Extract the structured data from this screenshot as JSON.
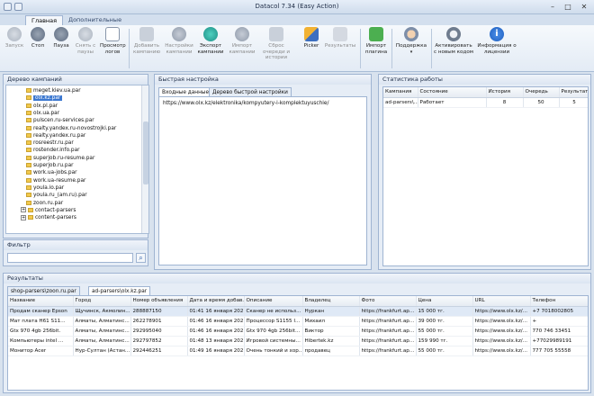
{
  "window": {
    "title": "Datacol 7.34 (Easy Action)"
  },
  "ribbon_tabs": [
    {
      "label": "Главная",
      "active": true
    },
    {
      "label": "Дополнительные",
      "active": false
    }
  ],
  "ribbon": {
    "start": "Запуск",
    "stop": "Стоп",
    "pause": "Пауза",
    "unpause": "Снять с паузы",
    "logs": "Просмотр логов",
    "add_campaign": "Добавить кампанию",
    "campaign_settings": "Настройки кампании",
    "export_campaigns": "Экспорт кампании",
    "import_campaigns": "Импорт кампании",
    "reset_queue": "Сброс очереди и истории",
    "picker": "Picker",
    "results": "Результаты",
    "import_plugin": "Импорт плагина",
    "support": "Поддержка",
    "activate_new_code": "Активировать с новым кодом",
    "license_info": "Информация о лицензии"
  },
  "campaign_tree": {
    "title": "Дерево кампаний",
    "items": [
      {
        "label": "meget.kiev.ua.par",
        "selected": false
      },
      {
        "label": "olx.kz.par",
        "selected": true
      },
      {
        "label": "olx.pl.par",
        "selected": false
      },
      {
        "label": "olx.ua.par",
        "selected": false
      },
      {
        "label": "pulscen.ru-services.par",
        "selected": false
      },
      {
        "label": "realty.yandex.ru-novostrojki.par",
        "selected": false
      },
      {
        "label": "realty.yandex.ru.par",
        "selected": false
      },
      {
        "label": "rosreestr.ru.par",
        "selected": false
      },
      {
        "label": "rostender.info.par",
        "selected": false
      },
      {
        "label": "superjob.ru-resume.par",
        "selected": false
      },
      {
        "label": "superjob.ru.par",
        "selected": false
      },
      {
        "label": "work.ua-jobs.par",
        "selected": false
      },
      {
        "label": "work.ua-resume.par",
        "selected": false
      },
      {
        "label": "youla.io.par",
        "selected": false
      },
      {
        "label": "youla.ru_(am.ru).par",
        "selected": false
      },
      {
        "label": "zoon.ru.par",
        "selected": false
      }
    ],
    "groups": [
      "contact-parsers",
      "content-parsers"
    ]
  },
  "filter": {
    "label": "Фильтр",
    "value": ""
  },
  "quick_settings": {
    "title": "Быстрая настройка",
    "tabs": [
      {
        "label": "Входные данные",
        "active": true
      },
      {
        "label": "Дерево быстрой настройки",
        "active": false
      }
    ],
    "input_value": "https://www.olx.kz/elektronika/kompyutery-i-komplektuyuschie/"
  },
  "stats": {
    "title": "Статистика работы",
    "columns": [
      "Кампания",
      "Состояние",
      "История",
      "Очередь",
      "Результаты"
    ],
    "rows": [
      [
        "ad-parsers\\...",
        "Работает",
        "8",
        "50",
        "5"
      ]
    ]
  },
  "results": {
    "title": "Результаты",
    "tabs": [
      {
        "label": "shop-parsers\\zoon.ru.par",
        "active": false
      },
      {
        "label": "ad-parsers\\olx.kz.par",
        "active": true
      }
    ],
    "columns": [
      "Название",
      "Город",
      "Номер объявления",
      "Дата и время добав...",
      "Описание",
      "Владелец",
      "Фото",
      "Цена",
      "URL",
      "Телефон"
    ],
    "rows": [
      [
        "Продам сканер Epson",
        "Щучинск, Акмолин...",
        "288887150",
        "01:41 16 января 2021",
        "Сканер не использ...",
        "Нуркан",
        "https://frankfurt.ap...",
        "15 000 тг.",
        "https://www.olx.kz/...",
        "+7 7018002805"
      ],
      [
        "Мат плата H61 S11...",
        "Алматы, Алматинс...",
        "262278901",
        "01:46 16 января 2021",
        "Процессор S1155 I...",
        "Михаил",
        "https://frankfurt.ap...",
        "39 000 тг.",
        "https://www.olx.kz/...",
        "+"
      ],
      [
        "Gtx 970 4gb 256bit.",
        "Алматы, Алматинс...",
        "292995040",
        "01:46 16 января 2021",
        "Gtx 970 4gb 256bit...",
        "Виктор",
        "https://frankfurt.ap...",
        "55 000 тг.",
        "https://www.olx.kz/...",
        "770 746 33451"
      ],
      [
        "Компьютеры intel ...",
        "Алматы, Алматинс...",
        "292797852",
        "01:48 13 января 2021",
        "Игровой системны...",
        "Hibertek.kz",
        "https://frankfurt.ap...",
        "159 990 тг.",
        "https://www.olx.kz/...",
        "+77029989191"
      ],
      [
        "Монитор Acer",
        "Нур-Султан (Астан...",
        "292446251",
        "01:49 16 января 2021",
        "Очень тонкий и хор...",
        "продавец",
        "https://frankfurt.ap...",
        "55 000 тг.",
        "https://www.olx.kz/...",
        "777 705 55558"
      ]
    ]
  }
}
